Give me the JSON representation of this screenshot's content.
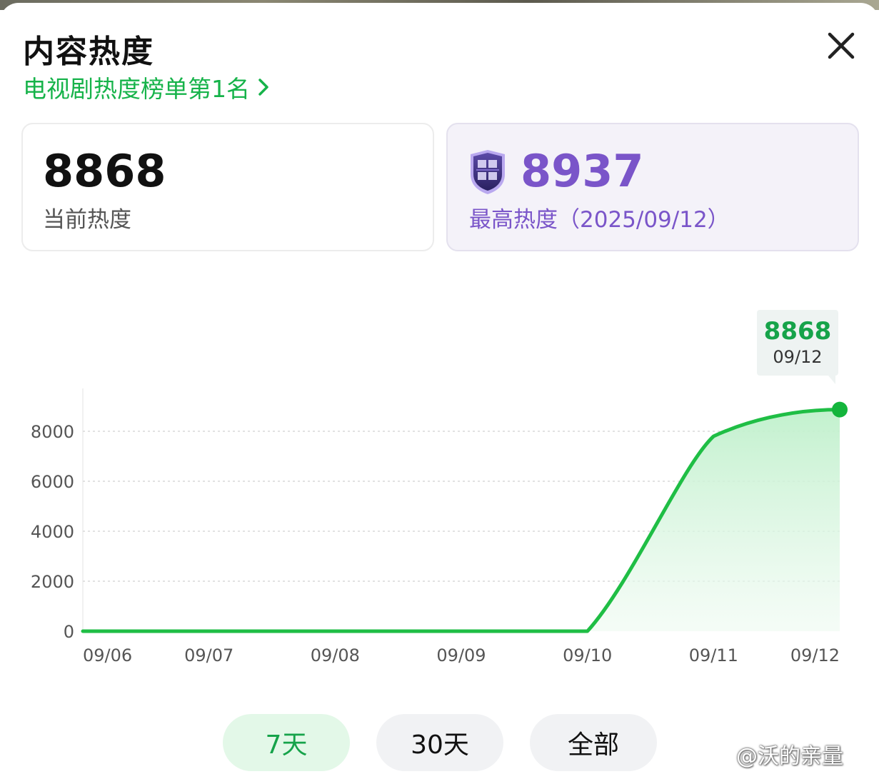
{
  "window": {
    "title": "内容热度",
    "close_icon": "close-icon"
  },
  "rank_link": {
    "label": "电视剧热度榜单第1名",
    "icon": "chevron-right-icon",
    "color": "#16b34a"
  },
  "current_card": {
    "value": "8868",
    "label": "当前热度"
  },
  "peak_card": {
    "badge_icon": "hall-of-fame-badge-icon",
    "value": "8937",
    "label": "最高热度（2025/09/12）",
    "color": "#7a55c9"
  },
  "tooltip": {
    "value": "8868",
    "date": "09/12"
  },
  "tabs": [
    {
      "label": "7天",
      "selected": true
    },
    {
      "label": "30天",
      "selected": false
    },
    {
      "label": "全部",
      "selected": false
    }
  ],
  "watermark": {
    "icon": "weibo-icon",
    "text": "@沃的亲量"
  },
  "chart_data": {
    "type": "area",
    "x": [
      "09/06",
      "09/07",
      "09/08",
      "09/09",
      "09/10",
      "09/11",
      "09/12"
    ],
    "series": [
      {
        "values": [
          0,
          0,
          0,
          0,
          0,
          7800,
          8868
        ],
        "color": "#1fbe45"
      }
    ],
    "y_ticks": [
      0,
      2000,
      4000,
      6000,
      8000
    ],
    "ylim": [
      0,
      8868
    ],
    "grid": true,
    "highlight": {
      "x": "09/12",
      "y": 8868
    }
  }
}
